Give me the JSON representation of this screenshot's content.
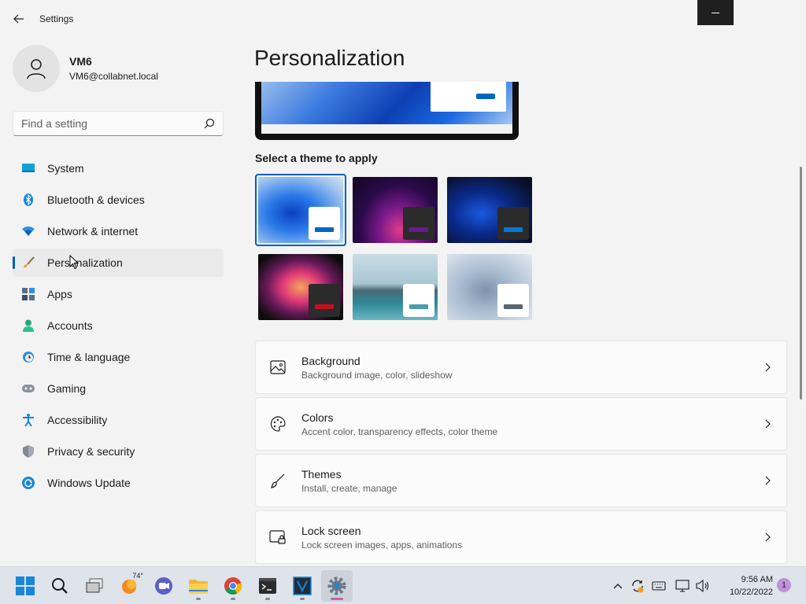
{
  "window": {
    "app_title": "Settings",
    "back_icon": "arrow-left-icon",
    "minimize_icon": "minimize-icon"
  },
  "profile": {
    "name": "VM6",
    "email": "VM6@collabnet.local",
    "avatar_icon": "person-icon"
  },
  "search": {
    "placeholder": "Find a setting",
    "value": "",
    "icon": "search-icon"
  },
  "sidebar": {
    "items": [
      {
        "label": "System",
        "icon": "monitor-icon",
        "active": false
      },
      {
        "label": "Bluetooth & devices",
        "icon": "bluetooth-icon",
        "active": false
      },
      {
        "label": "Network & internet",
        "icon": "wifi-icon",
        "active": false
      },
      {
        "label": "Personalization",
        "icon": "paintbrush-icon",
        "active": true
      },
      {
        "label": "Apps",
        "icon": "apps-icon",
        "active": false
      },
      {
        "label": "Accounts",
        "icon": "account-icon",
        "active": false
      },
      {
        "label": "Time & language",
        "icon": "clock-globe-icon",
        "active": false
      },
      {
        "label": "Gaming",
        "icon": "gamepad-icon",
        "active": false
      },
      {
        "label": "Accessibility",
        "icon": "accessibility-icon",
        "active": false
      },
      {
        "label": "Privacy & security",
        "icon": "shield-icon",
        "active": false
      },
      {
        "label": "Windows Update",
        "icon": "update-icon",
        "active": false
      }
    ]
  },
  "main": {
    "title": "Personalization",
    "theme_section_label": "Select a theme to apply",
    "themes": [
      {
        "name": "windows-light",
        "selected": true,
        "accent": "#0067c0",
        "window": "#ffffff"
      },
      {
        "name": "glow",
        "selected": false,
        "accent": "#6b1b8e",
        "window": "#2b2b2b"
      },
      {
        "name": "windows-dark",
        "selected": false,
        "accent": "#0078d4",
        "window": "#2b2b2b"
      },
      {
        "name": "captured-motion",
        "selected": false,
        "accent": "#c50f1f",
        "window": "#2b2b2b"
      },
      {
        "name": "sunrise",
        "selected": false,
        "accent": "#4a9bb0",
        "window": "#ffffff"
      },
      {
        "name": "flow",
        "selected": false,
        "accent": "#5a6470",
        "window": "#ffffff"
      }
    ],
    "cards": [
      {
        "title": "Background",
        "subtitle": "Background image, color, slideshow",
        "icon": "image-icon"
      },
      {
        "title": "Colors",
        "subtitle": "Accent color, transparency effects, color theme",
        "icon": "palette-icon"
      },
      {
        "title": "Themes",
        "subtitle": "Install, create, manage",
        "icon": "brush-icon"
      },
      {
        "title": "Lock screen",
        "subtitle": "Lock screen images, apps, animations",
        "icon": "lock-screen-icon"
      }
    ]
  },
  "taskbar": {
    "weather_temp": "74°",
    "time": "9:56 AM",
    "date": "10/22/2022",
    "notification_count": "1"
  },
  "colors": {
    "accent": "#005fb8",
    "background": "#f3f3f3",
    "card": "#fbfbfb"
  }
}
